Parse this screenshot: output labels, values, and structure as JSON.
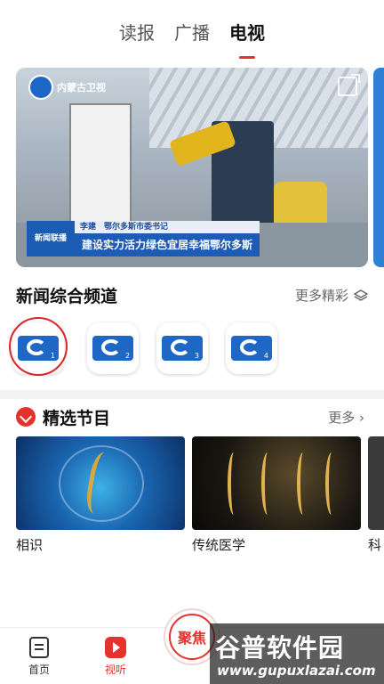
{
  "tabs": [
    "读报",
    "广播",
    "电视"
  ],
  "active_tab": "电视",
  "hero": {
    "station_logo": "内蒙古卫视",
    "lower_third_logo": "新闻联播",
    "lower_third_top": "李建　鄂尔多斯市委书记",
    "lower_third_main": "建设实力活力绿色宜居幸福鄂尔多斯"
  },
  "channels_section": {
    "title": "新闻综合频道",
    "more": "更多精彩",
    "channels": [
      "1",
      "2",
      "3",
      "4"
    ]
  },
  "programs_section": {
    "title": "精选节目",
    "more": "更多 ›",
    "programs": [
      {
        "label": "相识"
      },
      {
        "label": "传统医学"
      },
      {
        "label": "科"
      }
    ]
  },
  "bottom_nav": {
    "home": "首页",
    "listen": "视听",
    "focus": "聚焦"
  },
  "watermark": {
    "top": "谷普软件园",
    "bottom": "www.gupuxlazai.com"
  },
  "colors": {
    "accent": "#e5322d",
    "channel_blue": "#1e67c4"
  }
}
